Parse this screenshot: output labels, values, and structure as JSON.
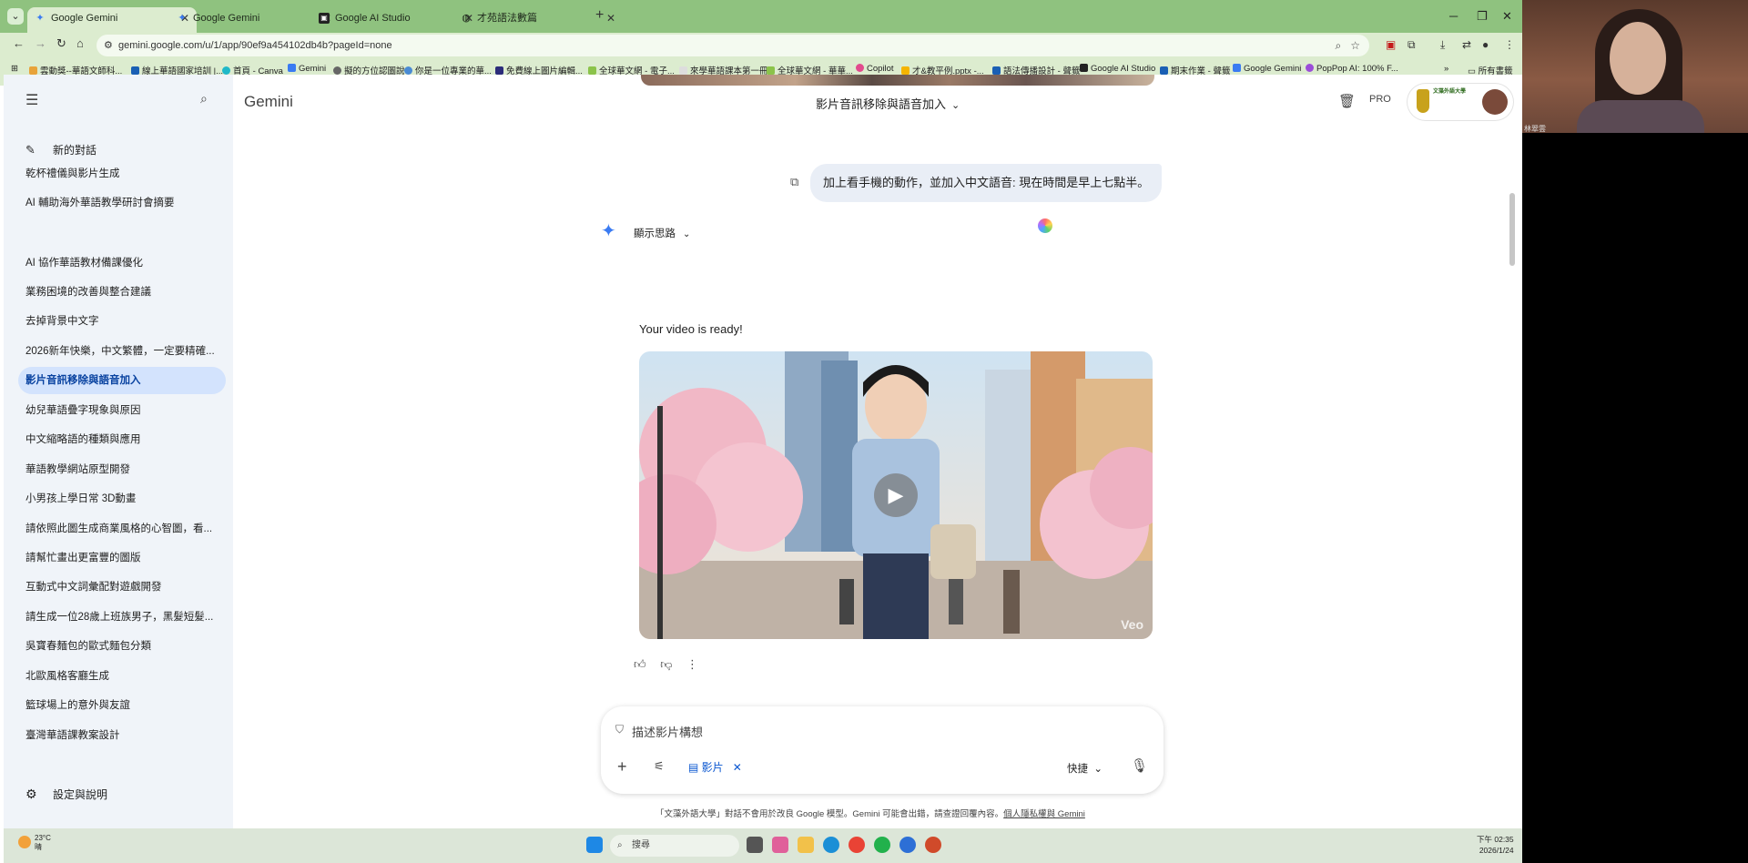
{
  "browser": {
    "tabs": [
      {
        "label": "Google Gemini",
        "active": true
      },
      {
        "label": "Google Gemini",
        "active": false
      },
      {
        "label": "Google AI Studio",
        "active": false
      },
      {
        "label": "才苑語法數篇",
        "active": false
      }
    ],
    "url": "gemini.google.com/u/1/app/90ef9a454102db4b?pageId=none",
    "bookmarks": [
      "雲動獎--華語文師科...",
      "線上華語國家培訓 |...",
      "首頁 - Canva",
      "Gemini",
      "擬的方位認圖說",
      "你是一位專業的華...",
      "免費線上圖片編輯...",
      "全球華文網 - 電子...",
      "來學華語課本第一冊",
      "全球華文網 - 華華...",
      "Copilot",
      "才&教平例.pptx -...",
      "語法傳播設計 - 聲籤",
      "Google AI Studio",
      "期末作業 - 聲籤",
      "Google Gemini",
      "PopPop AI: 100% F..."
    ],
    "all_bookmarks": "所有書籤",
    "accent": "#8fc27f"
  },
  "sidebar": {
    "new_chat": "新的對話",
    "items": [
      "乾杯禮儀與影片生成",
      "AI 輔助海外華語教學研討會摘要",
      "AI 協作華語教材備課優化",
      "業務困境的改善與整合建議",
      "去掉背景中文字",
      "2026新年快樂，中文繁體，一定要精確...",
      "影片音訊移除與語音加入",
      "幼兒華語疊字現象與原因",
      "中文縮略語的種類與應用",
      "華語教學網站原型開發",
      "小男孩上學日常 3D動畫",
      "請依照此圖生成商業風格的心智圖，看...",
      "請幫忙畫出更富豐的圖版",
      "互動式中文詞彙配對遊戲開發",
      "請生成一位28歲上班族男子，黑髮短髮...",
      "吳寶春麵包的歐式麵包分類",
      "北歐風格客廳生成",
      "籃球場上的意外與友誼",
      "臺灣華語課教案設計"
    ],
    "active_index": 6,
    "settings": "設定與說明"
  },
  "header": {
    "brand": "Gemini",
    "title": "影片音訊移除與語音加入",
    "pro": "PRO",
    "account_logo": "文藻外語大學"
  },
  "chat": {
    "user_message": "加上看手機的動作，並加入中文語音: 現在時間是早上七點半。",
    "show_thinking": "顯示思路",
    "reply": "Your video is ready!",
    "video_watermark": "Veo"
  },
  "composer": {
    "placeholder": "描述影片構想",
    "chip": "影片",
    "mode": "快捷",
    "disclaimer": "「文藻外語大學」對話不會用於改良 Google 模型。Gemini 可能會出錯，請查證回覆內容。",
    "privacy_link": "個人隱私權與 Gemini"
  },
  "taskbar": {
    "temp": "23°C",
    "weather": "晴",
    "search": "搜尋",
    "time": "下午 02:35",
    "date": "2026/1/24"
  },
  "webcam": {
    "name": "林翠雲"
  }
}
